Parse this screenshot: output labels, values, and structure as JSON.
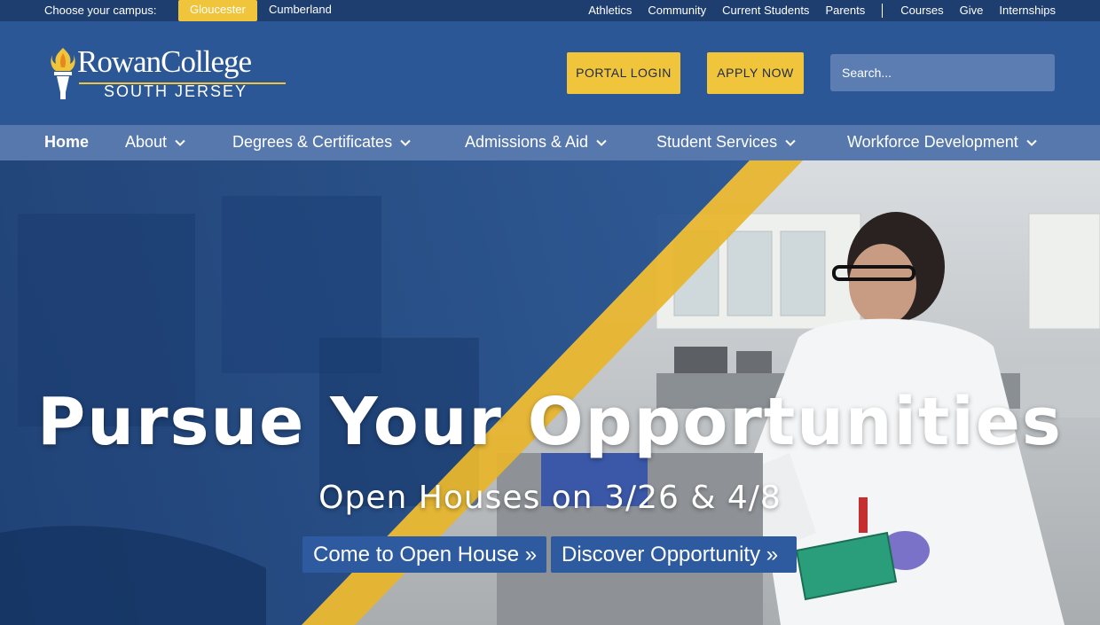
{
  "utility": {
    "campus_label": "Choose your campus:",
    "campuses": [
      "Gloucester",
      "Cumberland"
    ],
    "links": [
      "Athletics",
      "Community",
      "Current Students",
      "Parents",
      "Courses",
      "Give",
      "Internships"
    ]
  },
  "header": {
    "logo_title": "RowanCollege",
    "logo_subtitle": "SOUTH JERSEY",
    "portal_label": "PORTAL LOGIN",
    "apply_label": "APPLY NOW",
    "search_placeholder": "Search..."
  },
  "nav": {
    "items": [
      "Home",
      "About",
      "Degrees & Certificates",
      "Admissions & Aid",
      "Student Services",
      "Workforce Development"
    ]
  },
  "hero": {
    "title": "Pursue Your Opportunities",
    "subtitle": "Open Houses on 3/26 & 4/8",
    "cta_primary": "Come to Open House »",
    "cta_secondary": "Discover Opportunity »"
  },
  "colors": {
    "brand_blue": "#2c5797",
    "nav_blue": "#5678ad",
    "accent_gold": "#f0c43b",
    "utility_bar": "#1d3e6e"
  }
}
